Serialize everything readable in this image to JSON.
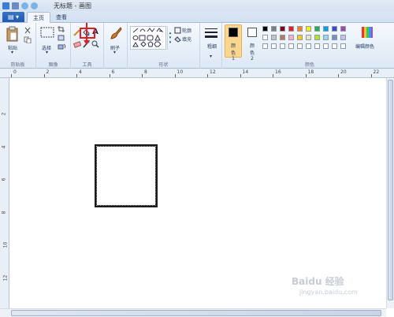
{
  "window": {
    "title": "无标题 - 画图"
  },
  "tabs": {
    "home": "主页",
    "view": "查看"
  },
  "ribbon": {
    "clipboard": {
      "paste": "粘贴",
      "group": "剪贴板"
    },
    "image": {
      "select": "选择",
      "group": "图像"
    },
    "tools": {
      "group": "工具",
      "text_icon_glyph": "A"
    },
    "brushes": {
      "label": "刷子"
    },
    "shapes": {
      "outline": "轮廓",
      "fill": "填充",
      "group": "形状"
    },
    "size": {
      "label": "粗细"
    },
    "color1": {
      "label": "颜色 1"
    },
    "color2": {
      "label": "颜色 2"
    },
    "colors": {
      "group": "颜色",
      "edit": "编辑颜色"
    }
  },
  "palette": {
    "row1": [
      "#000000",
      "#7f7f7f",
      "#880015",
      "#ed1c24",
      "#ff7f27",
      "#fff200",
      "#22b14c",
      "#00a2e8",
      "#3f48cc",
      "#a349a4"
    ],
    "row2": [
      "#ffffff",
      "#c3c3c3",
      "#b97a57",
      "#ffaec9",
      "#ffc90e",
      "#efe4b0",
      "#b5e61d",
      "#99d9ea",
      "#7092be",
      "#c8bfe7"
    ],
    "row3": [
      "#ffffff",
      "#ffffff",
      "#ffffff",
      "#ffffff",
      "#ffffff",
      "#ffffff",
      "#ffffff",
      "#ffffff",
      "#ffffff",
      "#ffffff"
    ]
  },
  "ruler": {
    "h_labels": [
      "0",
      "2",
      "4",
      "6",
      "8",
      "10",
      "12",
      "14",
      "16",
      "18",
      "20",
      "22"
    ],
    "v_labels": [
      "2",
      "4",
      "6",
      "8",
      "10",
      "12"
    ]
  },
  "watermark": {
    "brand": "Baidu 经验",
    "url": "jingyan.baidu.com"
  },
  "colors": {
    "accent": "#e02020",
    "color1_swatch": "#000000",
    "color2_swatch": "#ffffff"
  }
}
